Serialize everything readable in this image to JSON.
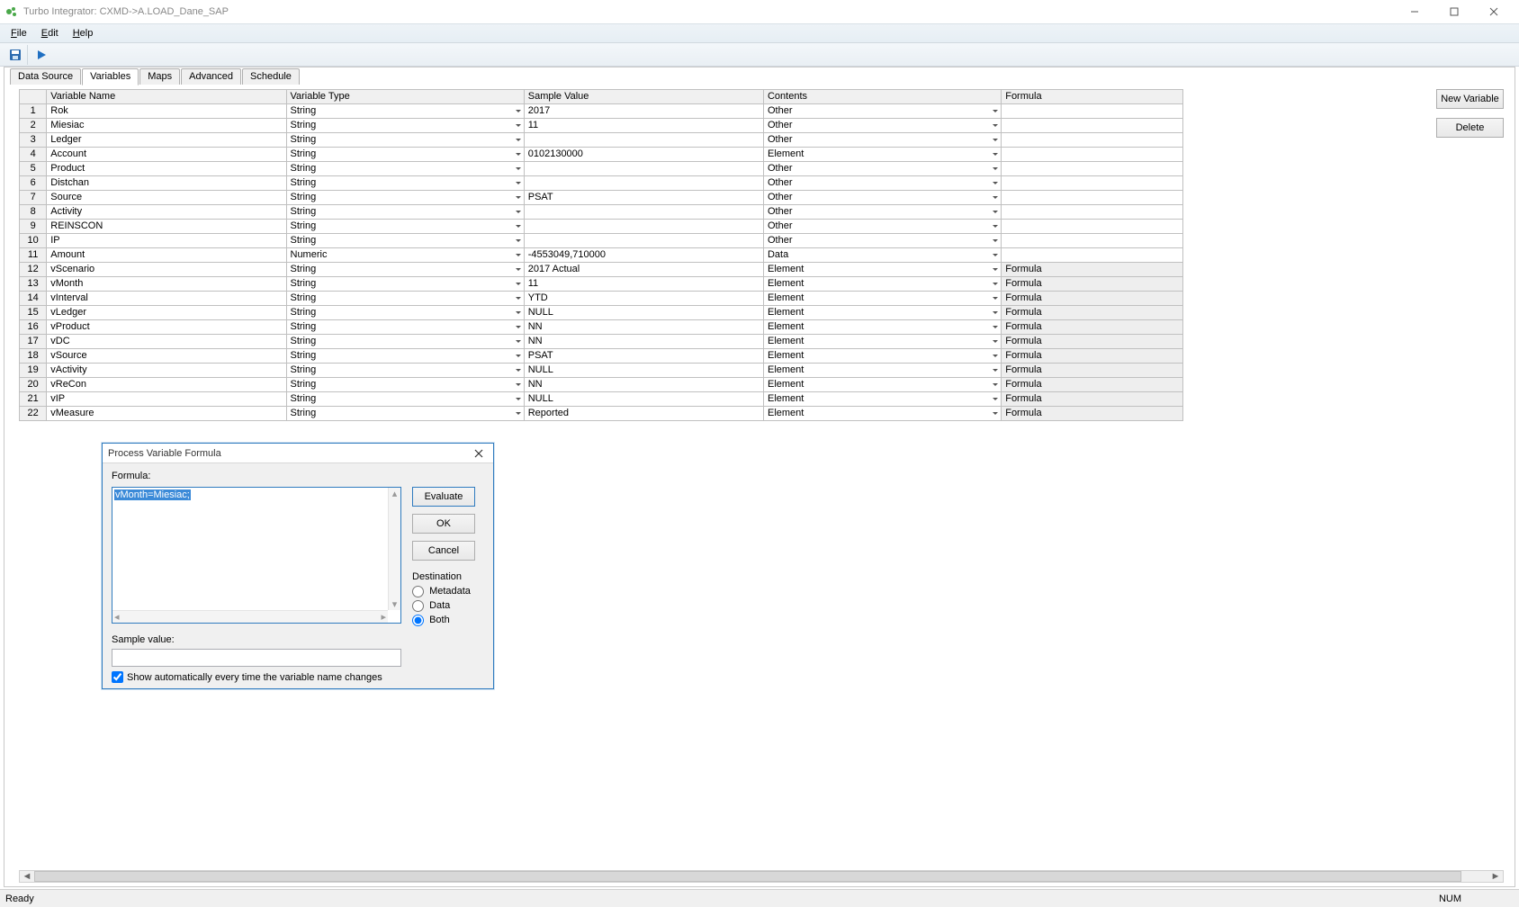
{
  "window": {
    "title": "Turbo Integrator:  CXMD->A.LOAD_Dane_SAP"
  },
  "menu": {
    "file": "File",
    "edit": "Edit",
    "help": "Help"
  },
  "tabs": {
    "datasource": "Data Source",
    "variables": "Variables",
    "maps": "Maps",
    "advanced": "Advanced",
    "schedule": "Schedule"
  },
  "grid": {
    "headers": {
      "name": "Variable Name",
      "type": "Variable Type",
      "sample": "Sample Value",
      "contents": "Contents",
      "formula": "Formula"
    },
    "rows": [
      {
        "n": "1",
        "name": "Rok",
        "type": "String",
        "sample": "2017",
        "contents": "Other",
        "formula": ""
      },
      {
        "n": "2",
        "name": "Miesiac",
        "type": "String",
        "sample": "11",
        "contents": "Other",
        "formula": ""
      },
      {
        "n": "3",
        "name": "Ledger",
        "type": "String",
        "sample": "",
        "contents": "Other",
        "formula": ""
      },
      {
        "n": "4",
        "name": "Account",
        "type": "String",
        "sample": "0102130000",
        "contents": "Element",
        "formula": ""
      },
      {
        "n": "5",
        "name": "Product",
        "type": "String",
        "sample": "",
        "contents": "Other",
        "formula": ""
      },
      {
        "n": "6",
        "name": "Distchan",
        "type": "String",
        "sample": "",
        "contents": "Other",
        "formula": ""
      },
      {
        "n": "7",
        "name": "Source",
        "type": "String",
        "sample": "PSAT",
        "contents": "Other",
        "formula": ""
      },
      {
        "n": "8",
        "name": "Activity",
        "type": "String",
        "sample": "",
        "contents": "Other",
        "formula": ""
      },
      {
        "n": "9",
        "name": "REINSCON",
        "type": "String",
        "sample": "",
        "contents": "Other",
        "formula": ""
      },
      {
        "n": "10",
        "name": "IP",
        "type": "String",
        "sample": "",
        "contents": "Other",
        "formula": ""
      },
      {
        "n": "11",
        "name": "Amount",
        "type": "Numeric",
        "sample": "-4553049,710000",
        "contents": "Data",
        "formula": ""
      },
      {
        "n": "12",
        "name": "vScenario",
        "type": "String",
        "sample": "2017 Actual",
        "contents": "Element",
        "formula": "Formula"
      },
      {
        "n": "13",
        "name": "vMonth",
        "type": "String",
        "sample": "11",
        "contents": "Element",
        "formula": "Formula"
      },
      {
        "n": "14",
        "name": "vInterval",
        "type": "String",
        "sample": "YTD",
        "contents": "Element",
        "formula": "Formula"
      },
      {
        "n": "15",
        "name": "vLedger",
        "type": "String",
        "sample": "NULL",
        "contents": "Element",
        "formula": "Formula"
      },
      {
        "n": "16",
        "name": "vProduct",
        "type": "String",
        "sample": "NN",
        "contents": "Element",
        "formula": "Formula"
      },
      {
        "n": "17",
        "name": "vDC",
        "type": "String",
        "sample": "NN",
        "contents": "Element",
        "formula": "Formula"
      },
      {
        "n": "18",
        "name": "vSource",
        "type": "String",
        "sample": "PSAT",
        "contents": "Element",
        "formula": "Formula"
      },
      {
        "n": "19",
        "name": "vActivity",
        "type": "String",
        "sample": "NULL",
        "contents": "Element",
        "formula": "Formula"
      },
      {
        "n": "20",
        "name": "vReCon",
        "type": "String",
        "sample": "NN",
        "contents": "Element",
        "formula": "Formula"
      },
      {
        "n": "21",
        "name": "vIP",
        "type": "String",
        "sample": "NULL",
        "contents": "Element",
        "formula": "Formula"
      },
      {
        "n": "22",
        "name": "vMeasure",
        "type": "String",
        "sample": "Reported",
        "contents": "Element",
        "formula": "Formula"
      }
    ]
  },
  "buttons": {
    "new_variable": "New Variable",
    "delete": "Delete"
  },
  "dialog": {
    "title": "Process Variable Formula",
    "formula_label": "Formula:",
    "formula_text": "vMonth=Miesiac;",
    "evaluate": "Evaluate",
    "ok": "OK",
    "cancel": "Cancel",
    "destination_label": "Destination",
    "dest_metadata": "Metadata",
    "dest_data": "Data",
    "dest_both": "Both",
    "sample_label": "Sample value:",
    "sample_value": "",
    "auto_label": "Show automatically every time the variable name changes"
  },
  "status": {
    "ready": "Ready",
    "num": "NUM"
  }
}
